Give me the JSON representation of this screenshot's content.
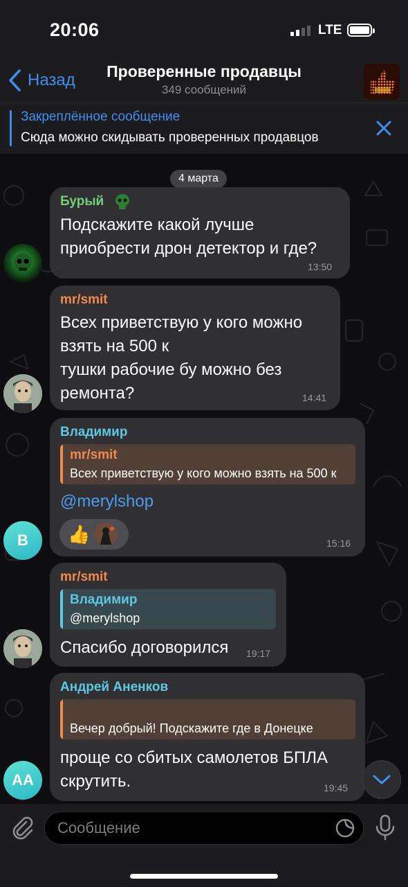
{
  "status_bar": {
    "time": "20:06",
    "network": "LTE"
  },
  "header": {
    "back_label": "Назад",
    "title": "Проверенные продавцы",
    "subtitle": "349 сообщений"
  },
  "pinned": {
    "title": "Закреплённое сообщение",
    "text": "Сюда можно скидывать проверенных продавцов"
  },
  "chat": {
    "date": "4 марта",
    "messages": [
      {
        "sender": "Бурый",
        "sender_color": "#6fcf7b",
        "text": "Подскажите какой лучше\nприобрести дрон детектор и где?",
        "time": "13:50"
      },
      {
        "sender": "mr/smit",
        "sender_color": "#f08a4b",
        "text": "Всех приветствую у кого можно\nвзять на 500 к\nтушки рабочие бу можно без\nремонта?",
        "time": "14:41"
      },
      {
        "sender": "Владимир",
        "sender_color": "#5ec8e3",
        "reply_name": "mr/smit",
        "reply_text": "Всех приветствую у кого можно взять на 500 к",
        "text": "@merylshop",
        "time": "15:16",
        "avatar_letter": "В",
        "reactions": [
          "thumbs-up",
          "user-avatar"
        ]
      },
      {
        "sender": "mr/smit",
        "sender_color": "#f08a4b",
        "reply_name": "Владимир",
        "reply_text": "@merylshop",
        "text": "Спасибо договорился",
        "time": "19:17"
      },
      {
        "sender": "Андрей Аненков",
        "sender_color": "#5ec8e3",
        "reply_text": "Вечер добрый! Подскажите где в Донецке",
        "text": "проще со сбитых самолетов БПЛА\nскрутить.",
        "time": "19:45",
        "avatar_letter": "АА"
      }
    ]
  },
  "input": {
    "placeholder": "Сообщение"
  },
  "colors": {
    "accent": "#3e8ef0",
    "bubble": "#38383c",
    "link": "#4c9bf0"
  }
}
